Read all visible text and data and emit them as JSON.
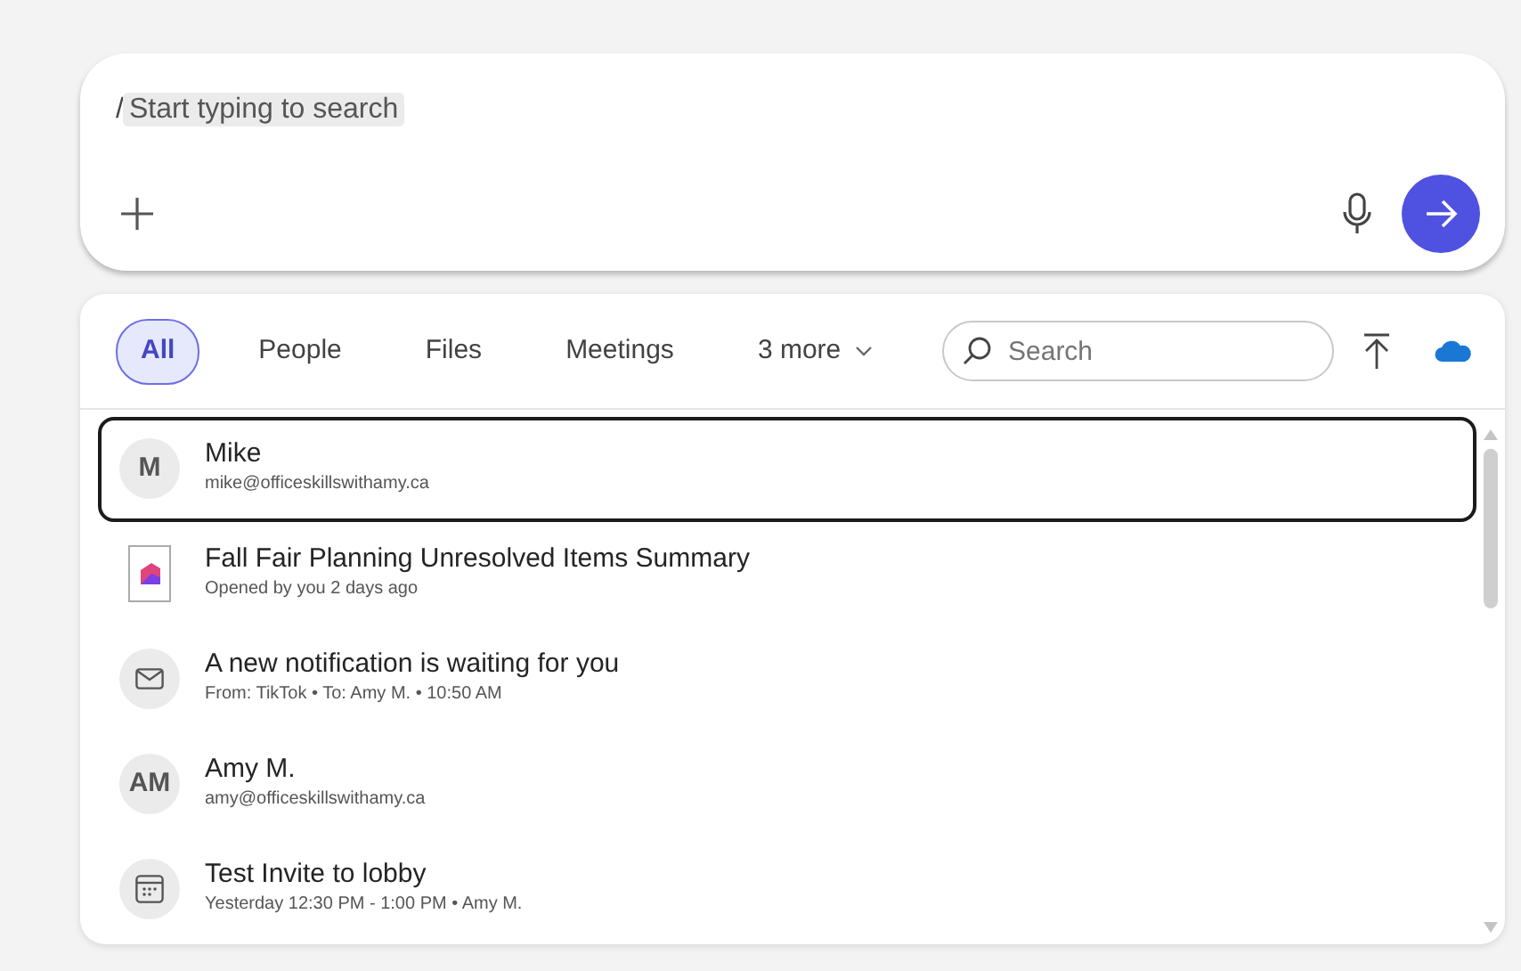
{
  "composer": {
    "prefix": "/",
    "hint": "Start typing to search"
  },
  "filters": [
    {
      "label": "All",
      "selected": true
    },
    {
      "label": "People",
      "selected": false
    },
    {
      "label": "Files",
      "selected": false
    },
    {
      "label": "Meetings",
      "selected": false
    },
    {
      "label": "3 more",
      "selected": false,
      "dropdown": true
    }
  ],
  "search": {
    "placeholder": "Search"
  },
  "results": [
    {
      "kind": "person",
      "initials": "M",
      "title": "Mike",
      "subtitle": "mike@officeskillswithamy.ca",
      "selected": true
    },
    {
      "kind": "file",
      "title": "Fall Fair Planning Unresolved Items Summary",
      "subtitle": "Opened by you 2 days ago",
      "selected": false
    },
    {
      "kind": "mail",
      "title": "A new notification is waiting for you",
      "subtitle": "From: TikTok • To: Amy M. • 10:50 AM",
      "selected": false
    },
    {
      "kind": "person",
      "initials": "AM",
      "title": "Amy M.",
      "subtitle": "amy@officeskillswithamy.ca",
      "selected": false
    },
    {
      "kind": "meeting",
      "title": "Test Invite to lobby",
      "subtitle": "Yesterday 12:30 PM - 1:00 PM • Amy M.",
      "selected": false
    }
  ]
}
